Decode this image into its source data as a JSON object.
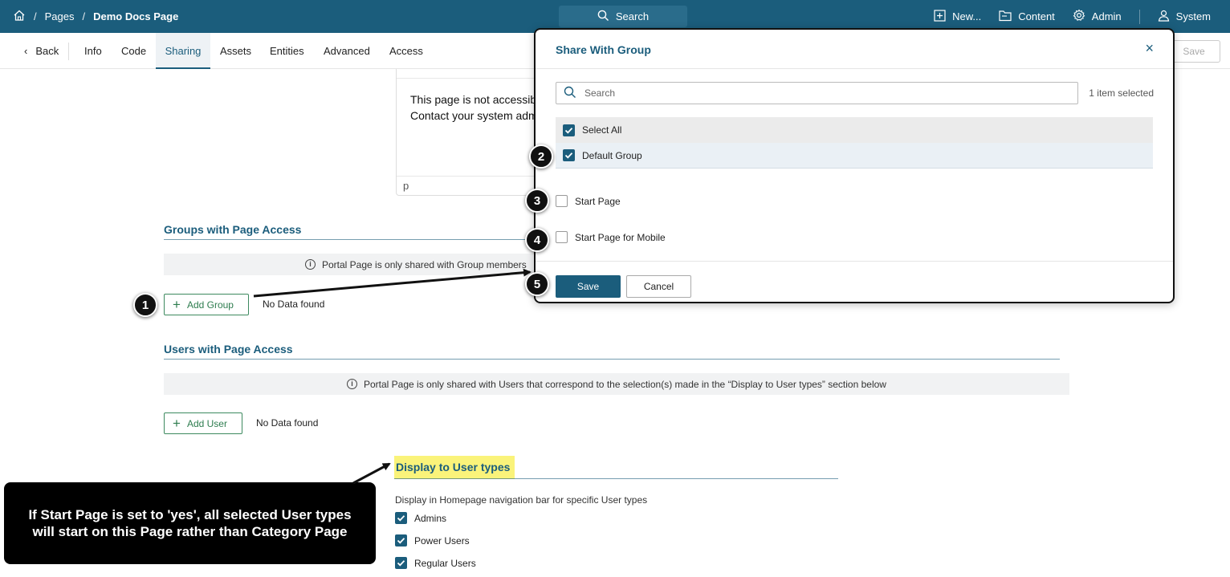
{
  "topbar": {
    "breadcrumb": [
      "Pages",
      "Demo Docs Page"
    ],
    "search_label": "Search",
    "menu": {
      "new": "New...",
      "content": "Content",
      "admin": "Admin",
      "system": "System"
    }
  },
  "tabs": {
    "back": "Back",
    "items": [
      "Info",
      "Code",
      "Sharing",
      "Assets",
      "Entities",
      "Advanced",
      "Access"
    ],
    "active": "Sharing",
    "save": "Save"
  },
  "editor": {
    "line1": "This page is not accessib",
    "line2": "Contact your system adm",
    "status": "p"
  },
  "groups_section": {
    "title": "Groups with Page Access",
    "info": "Portal Page is only shared with Group members",
    "add_button": "Add Group",
    "no_data": "No Data found"
  },
  "users_section": {
    "title": "Users with Page Access",
    "info": "Portal Page is only shared with Users that correspond to the selection(s) made in the “Display to User types” section below",
    "add_button": "Add User",
    "no_data": "No Data found"
  },
  "user_types": {
    "title": "Display to User types",
    "subtitle": "Display in Homepage navigation bar for specific User types",
    "items": [
      {
        "label": "Admins",
        "checked": true
      },
      {
        "label": "Power Users",
        "checked": true
      },
      {
        "label": "Regular Users",
        "checked": true
      }
    ]
  },
  "note": {
    "line1": "If Start Page is set to 'yes', all selected User types",
    "line2": "will start on this Page rather than Category Page"
  },
  "dialog": {
    "title": "Share With Group",
    "search_placeholder": "Search",
    "selected_count": "1 item selected",
    "select_all": "Select All",
    "group": "Default Group",
    "start_page": "Start Page",
    "start_page_mobile": "Start Page for Mobile",
    "save": "Save",
    "cancel": "Cancel"
  },
  "badges": [
    "1",
    "2",
    "3",
    "4",
    "5"
  ],
  "colors": {
    "brand": "#1b5d7c",
    "add_button": "#2e7d4f",
    "highlight": "#faf37a"
  }
}
